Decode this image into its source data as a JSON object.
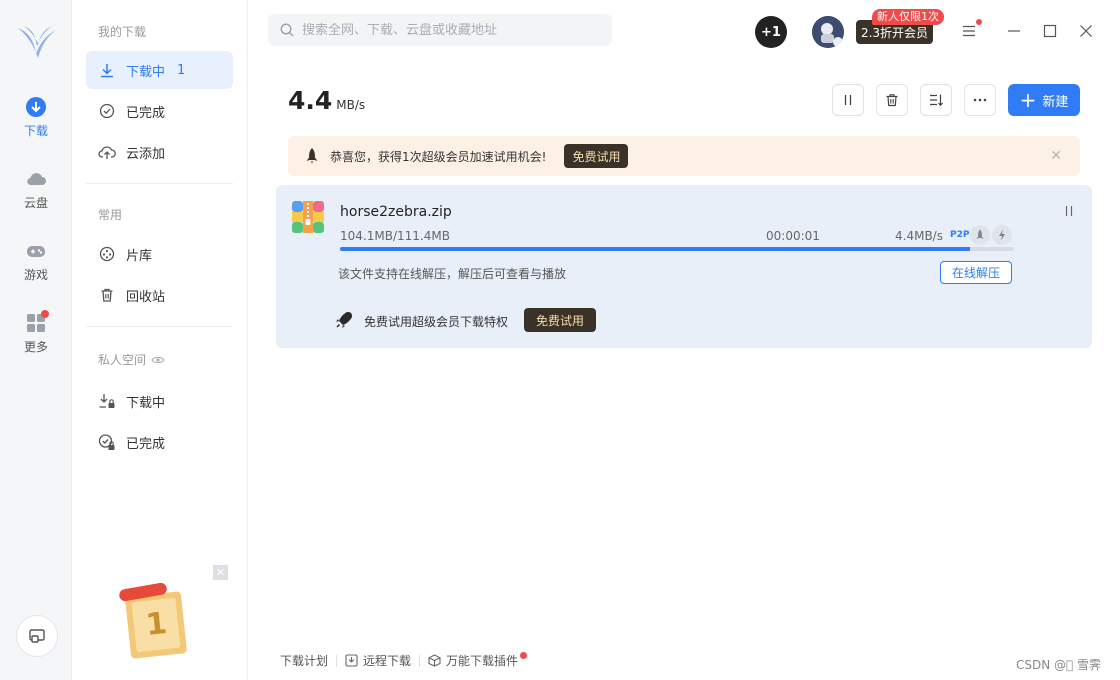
{
  "rail": {
    "items": [
      {
        "label": "下载",
        "icon": "download-icon"
      },
      {
        "label": "云盘",
        "icon": "cloud-icon"
      },
      {
        "label": "游戏",
        "icon": "gamepad-icon"
      },
      {
        "label": "更多",
        "icon": "apps-icon"
      }
    ]
  },
  "sidebar": {
    "my_downloads_title": "我的下载",
    "downloading_label": "下载中",
    "downloading_count": "1",
    "completed_label": "已完成",
    "cloud_add_label": "云添加",
    "common_title": "常用",
    "library_label": "片库",
    "recycle_label": "回收站",
    "private_title": "私人空间",
    "private_downloading_label": "下载中",
    "private_completed_label": "已完成"
  },
  "topbar": {
    "search_placeholder": "搜索全网、下载、云盘或收藏地址",
    "plus_badge": "+1",
    "vip_button": "2.3折开会员",
    "vip_tag": "新人仅限1次"
  },
  "toolbar": {
    "speed_value": "4.4",
    "speed_unit": "MB/s",
    "new_label": "新建"
  },
  "banner": {
    "message": "恭喜您，获得1次超级会员加速试用机会!",
    "button": "免费试用"
  },
  "task": {
    "filename": "horse2zebra.zip",
    "size": "104.1MB/111.4MB",
    "eta": "00:00:01",
    "speed": "4.4MB/s",
    "p2p": "P2P",
    "progress": 0.934,
    "hint": "该文件支持在线解压，解压后可查看与播放",
    "unzip_button": "在线解压",
    "vip_line": "免费试用超级会员下载特权",
    "vip_button": "免费试用"
  },
  "footer": {
    "plan": "下载计划",
    "remote": "远程下载",
    "plugin": "万能下载插件"
  },
  "watermark": "CSDN @\u0000 雪霁",
  "colors": {
    "accent": "#2f7cf6",
    "vip_dark": "#3a3226",
    "alert": "#f04b4b"
  }
}
